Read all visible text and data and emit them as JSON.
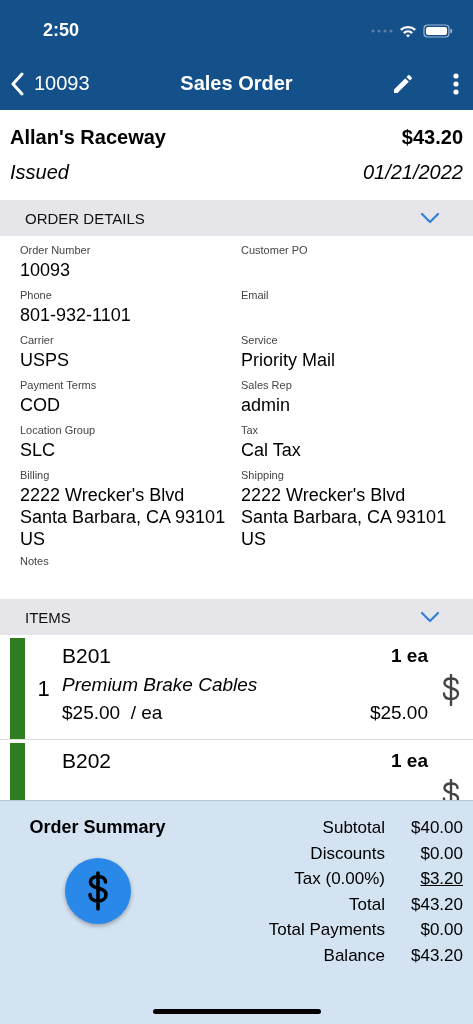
{
  "status_bar": {
    "time": "2:50"
  },
  "nav": {
    "back_label": "10093",
    "title": "Sales Order"
  },
  "header": {
    "customer": "Allan's Raceway",
    "amount": "$43.20",
    "status": "Issued",
    "date": "01/21/2022"
  },
  "order_details": {
    "title": "ORDER DETAILS",
    "expanded": true,
    "fields": [
      {
        "label": "Order Number",
        "value": "10093"
      },
      {
        "label": "Customer PO"
      },
      {
        "label": "Phone",
        "value": "801-932-1101"
      },
      {
        "label": "Email"
      },
      {
        "label": "Carrier",
        "value": "USPS"
      },
      {
        "label": "Service",
        "value": "Priority Mail"
      },
      {
        "label": "Payment Terms",
        "value": "COD"
      },
      {
        "label": "Sales Rep",
        "value": "admin"
      },
      {
        "label": "Location Group",
        "value": "SLC"
      },
      {
        "label": "Tax",
        "value": "Cal Tax"
      },
      {
        "label": "Billing",
        "value": "2222 Wrecker's Blvd\nSanta Barbara, CA 93101\nUS"
      },
      {
        "label": "Shipping",
        "value": "2222 Wrecker's Blvd\nSanta Barbara, CA 93101\nUS"
      },
      {
        "label": "Notes"
      }
    ]
  },
  "items": {
    "title": "ITEMS",
    "expanded": true,
    "rows": [
      {
        "line": "1",
        "code": "B201",
        "description": "Premium Brake Cables",
        "unit_price": "$25.00",
        "unit": "/ ea",
        "quantity": "1 ea",
        "total": "$25.00",
        "color": "#2e7d1f"
      },
      {
        "code": "B202",
        "quantity": "1 ea",
        "color": "#2e7d1f"
      }
    ]
  },
  "summary": {
    "title": "Order Summary",
    "lines": [
      {
        "label": "Subtotal",
        "value": "$40.00",
        "underlined": false
      },
      {
        "label": "Discounts",
        "value": "$0.00",
        "underlined": false
      },
      {
        "label": "Tax (0.00%)",
        "value": "$3.20",
        "underlined": true
      },
      {
        "label": "Total",
        "value": "$43.20",
        "underlined": false
      },
      {
        "label": "Total Payments",
        "value": "$0.00",
        "underlined": false
      },
      {
        "label": "Balance",
        "value": "$43.20",
        "underlined": false
      }
    ]
  }
}
